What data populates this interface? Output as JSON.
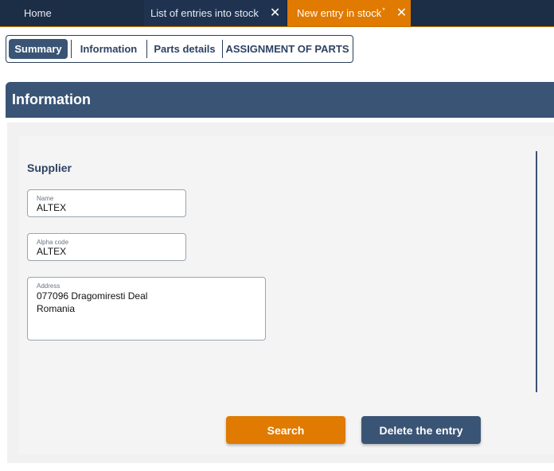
{
  "top_tabs": {
    "home": "Home",
    "list": "List of entries into stock",
    "new_entry": "New entry in stock",
    "new_entry_marker": "*",
    "close_glyph": "✕"
  },
  "sub_tabs": [
    {
      "label": "Summary",
      "active": true
    },
    {
      "label": "Information",
      "active": false
    },
    {
      "label": "Parts details",
      "active": false
    },
    {
      "label": "ASSIGNMENT OF PARTS",
      "active": false
    }
  ],
  "section": {
    "title": "Information"
  },
  "supplier": {
    "title": "Supplier",
    "name": {
      "label": "Name",
      "value": "ALTEX"
    },
    "alpha_code": {
      "label": "Alpha code",
      "value": "ALTEX"
    },
    "address": {
      "label": "Address",
      "lines": [
        "077096 Dragomiresti Deal",
        "Romania"
      ]
    }
  },
  "buttons": {
    "search": "Search",
    "delete": "Delete the entry"
  },
  "colors": {
    "accent_orange": "#e07a00",
    "navy": "#3a5475",
    "topbar": "#1c2d46"
  }
}
